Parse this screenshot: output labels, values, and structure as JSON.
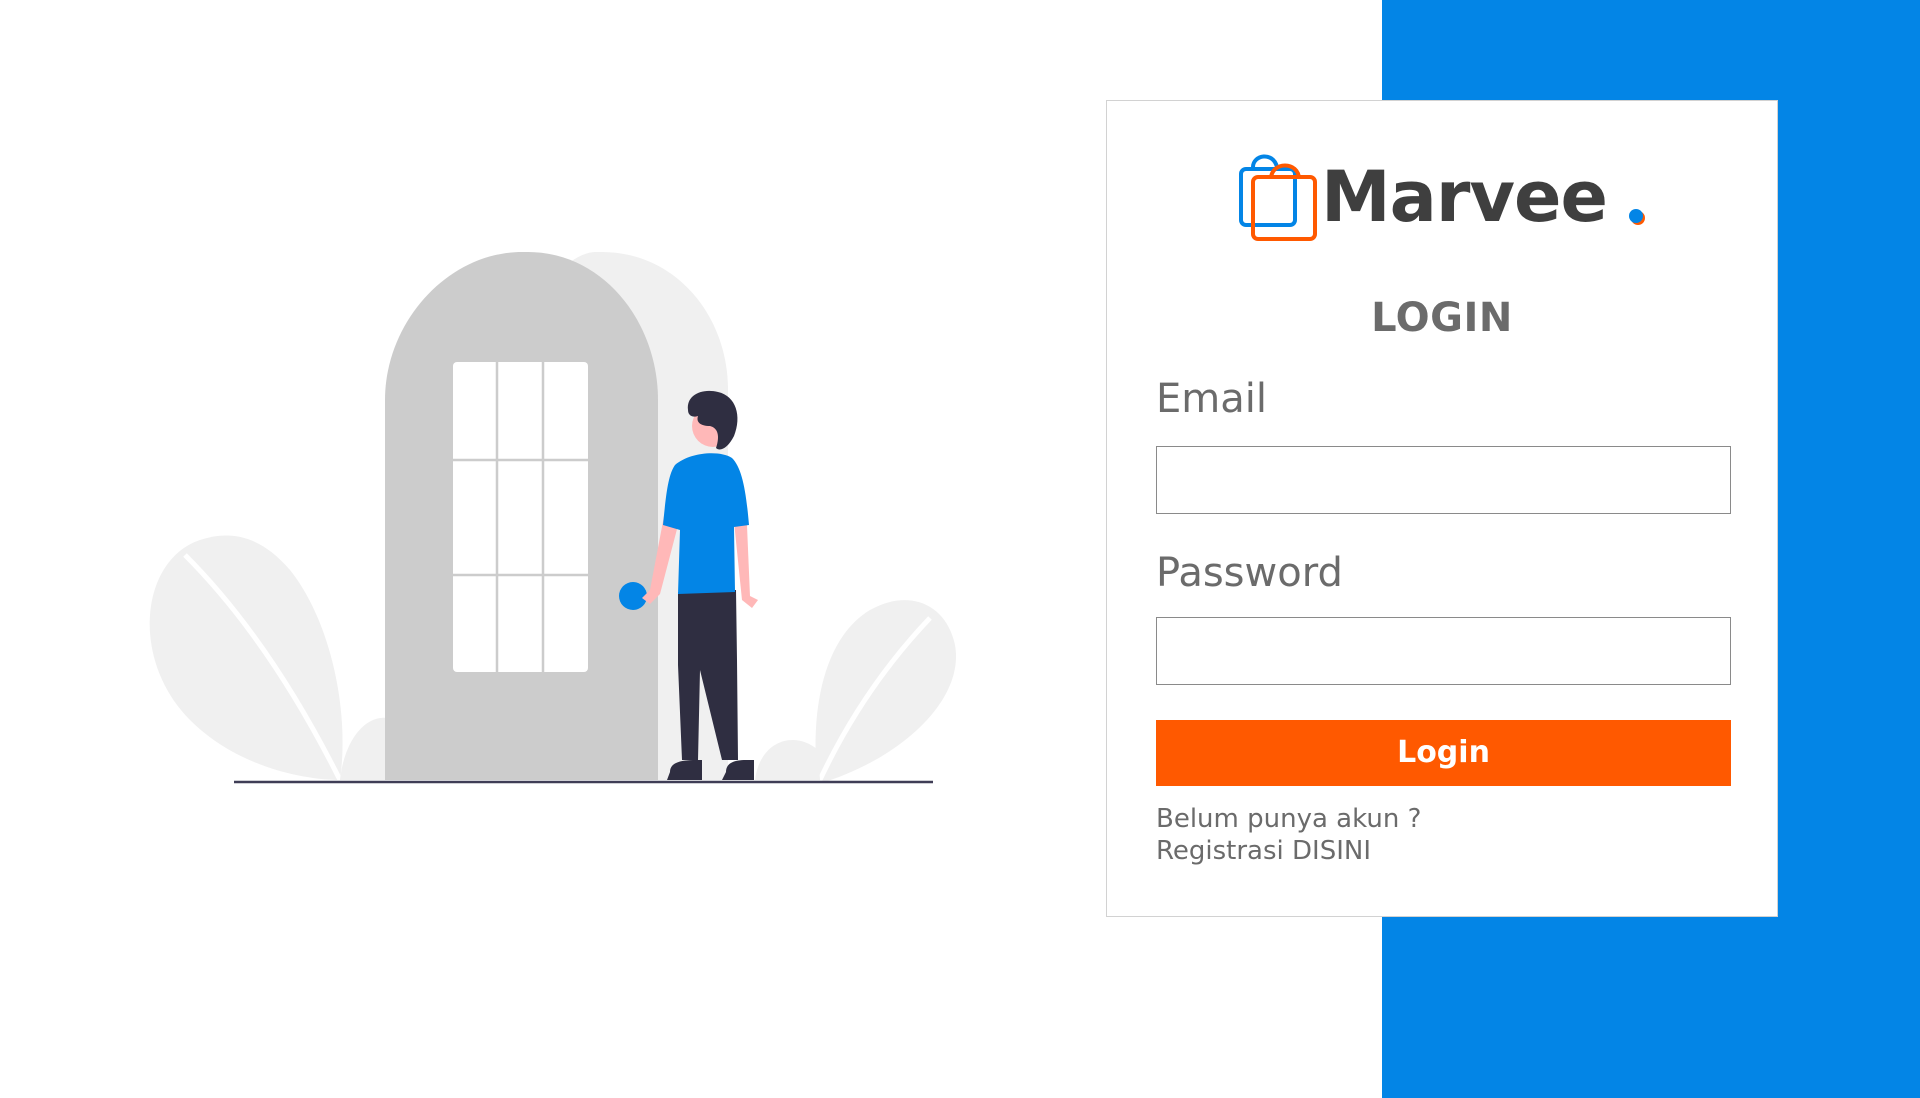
{
  "app": {
    "brand_name": "Marvee",
    "brand_colors": {
      "blue": "#0385e6",
      "orange": "#ff5900",
      "text": "#3f3f3f"
    },
    "logo_icon": "shopping-bag-icon",
    "accent_dot_icon": "dot-icon"
  },
  "illustration": {
    "icon": "person-at-door-illustration"
  },
  "login_form": {
    "title": "LOGIN",
    "email": {
      "label": "Email",
      "value": "",
      "placeholder": ""
    },
    "password": {
      "label": "Password",
      "value": "",
      "placeholder": ""
    },
    "submit_label": "Login",
    "register_prompt": "Belum punya akun ?",
    "register_link_label": "Registrasi DISINI"
  }
}
